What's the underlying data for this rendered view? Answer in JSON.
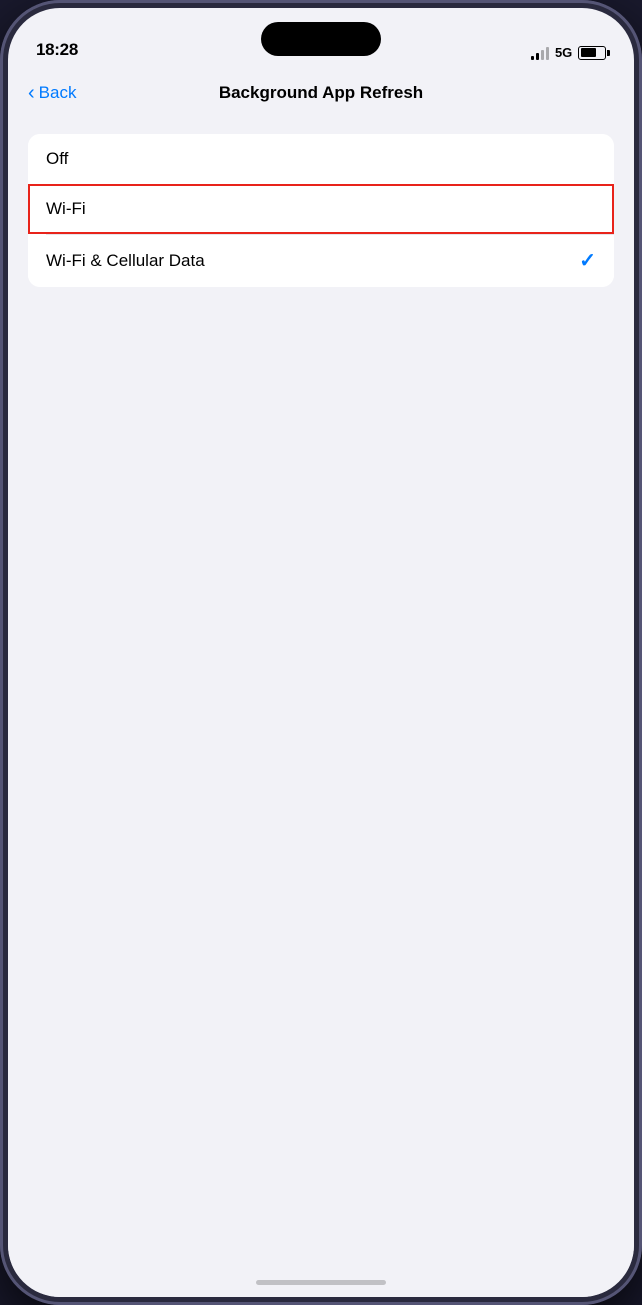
{
  "status_bar": {
    "time": "18:28",
    "network": "5G",
    "battery_percent": "68"
  },
  "nav": {
    "back_label": "Back",
    "title": "Background App Refresh"
  },
  "options": [
    {
      "id": "off",
      "label": "Off",
      "highlighted": false,
      "checked": false
    },
    {
      "id": "wifi",
      "label": "Wi-Fi",
      "highlighted": true,
      "checked": false
    },
    {
      "id": "wifi-cellular",
      "label": "Wi-Fi & Cellular Data",
      "highlighted": false,
      "checked": true
    }
  ],
  "icons": {
    "back_chevron": "‹",
    "checkmark": "✓"
  }
}
